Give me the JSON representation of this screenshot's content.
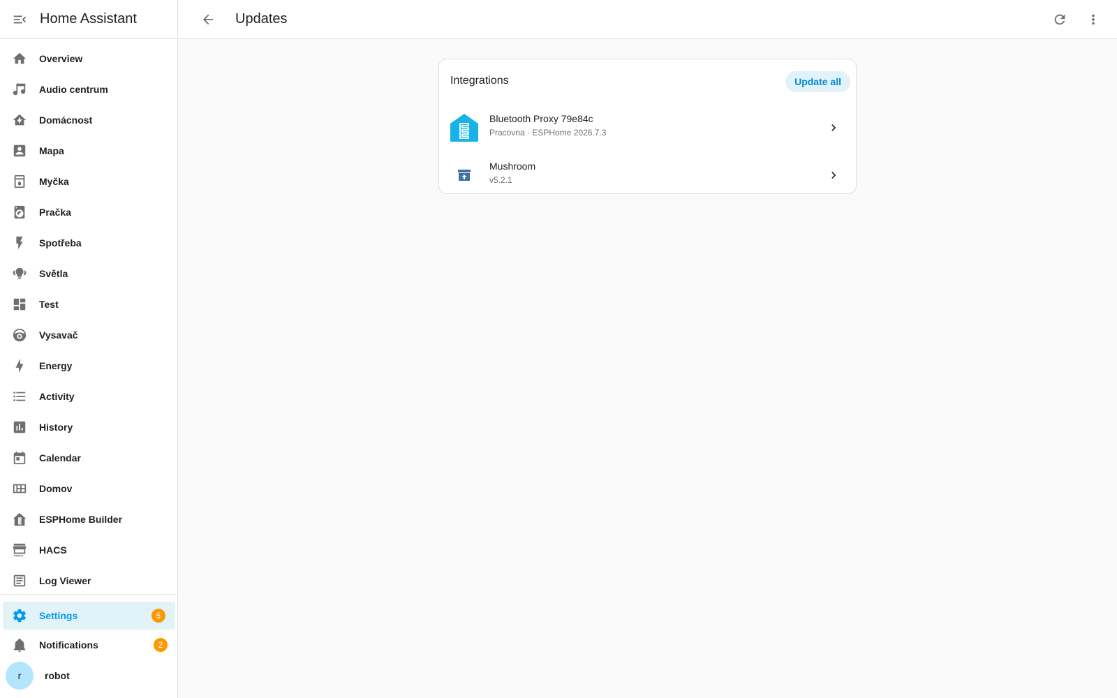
{
  "app": {
    "title": "Home Assistant"
  },
  "sidebar": {
    "items": [
      {
        "label": "Overview",
        "icon": "home-icon"
      },
      {
        "label": "Audio centrum",
        "icon": "music-note-icon"
      },
      {
        "label": "Domácnost",
        "icon": "home-lightning-icon"
      },
      {
        "label": "Mapa",
        "icon": "account-box-icon"
      },
      {
        "label": "Myčka",
        "icon": "dishwasher-icon"
      },
      {
        "label": "Pračka",
        "icon": "washing-machine-icon"
      },
      {
        "label": "Spotřeba",
        "icon": "flash-icon"
      },
      {
        "label": "Světla",
        "icon": "lightbulb-group-icon"
      },
      {
        "label": "Test",
        "icon": "view-dashboard-icon"
      },
      {
        "label": "Vysavač",
        "icon": "robot-vacuum-icon"
      },
      {
        "label": "Energy",
        "icon": "lightning-bolt-icon"
      },
      {
        "label": "Activity",
        "icon": "format-list-bulleted-icon"
      },
      {
        "label": "History",
        "icon": "chart-box-icon"
      },
      {
        "label": "Calendar",
        "icon": "calendar-icon"
      },
      {
        "label": "Domov",
        "icon": "view-dashboard-variant-icon"
      },
      {
        "label": "ESPHome Builder",
        "icon": "esphome-icon"
      },
      {
        "label": "HACS",
        "icon": "hacs-icon"
      },
      {
        "label": "Log Viewer",
        "icon": "text-box-icon"
      }
    ],
    "settings": {
      "label": "Settings",
      "badge": "5",
      "icon": "cog-icon"
    },
    "notifications": {
      "label": "Notifications",
      "badge": "2",
      "icon": "bell-icon"
    },
    "user": {
      "initial": "r",
      "name": "robot"
    }
  },
  "topbar": {
    "title": "Updates"
  },
  "card": {
    "title": "Integrations",
    "update_all_label": "Update all",
    "updates": [
      {
        "name": "Bluetooth Proxy 79e84c",
        "detail": "Pracovna · ESPHome 2026.7.3",
        "icon": "esphome-logo-icon"
      },
      {
        "name": "Mushroom",
        "detail": "v5.2.1",
        "icon": "hacs-package-icon"
      }
    ]
  },
  "colors": {
    "accent": "#039be5",
    "badge": "#ff9800",
    "esphome": "#18b2e8"
  }
}
